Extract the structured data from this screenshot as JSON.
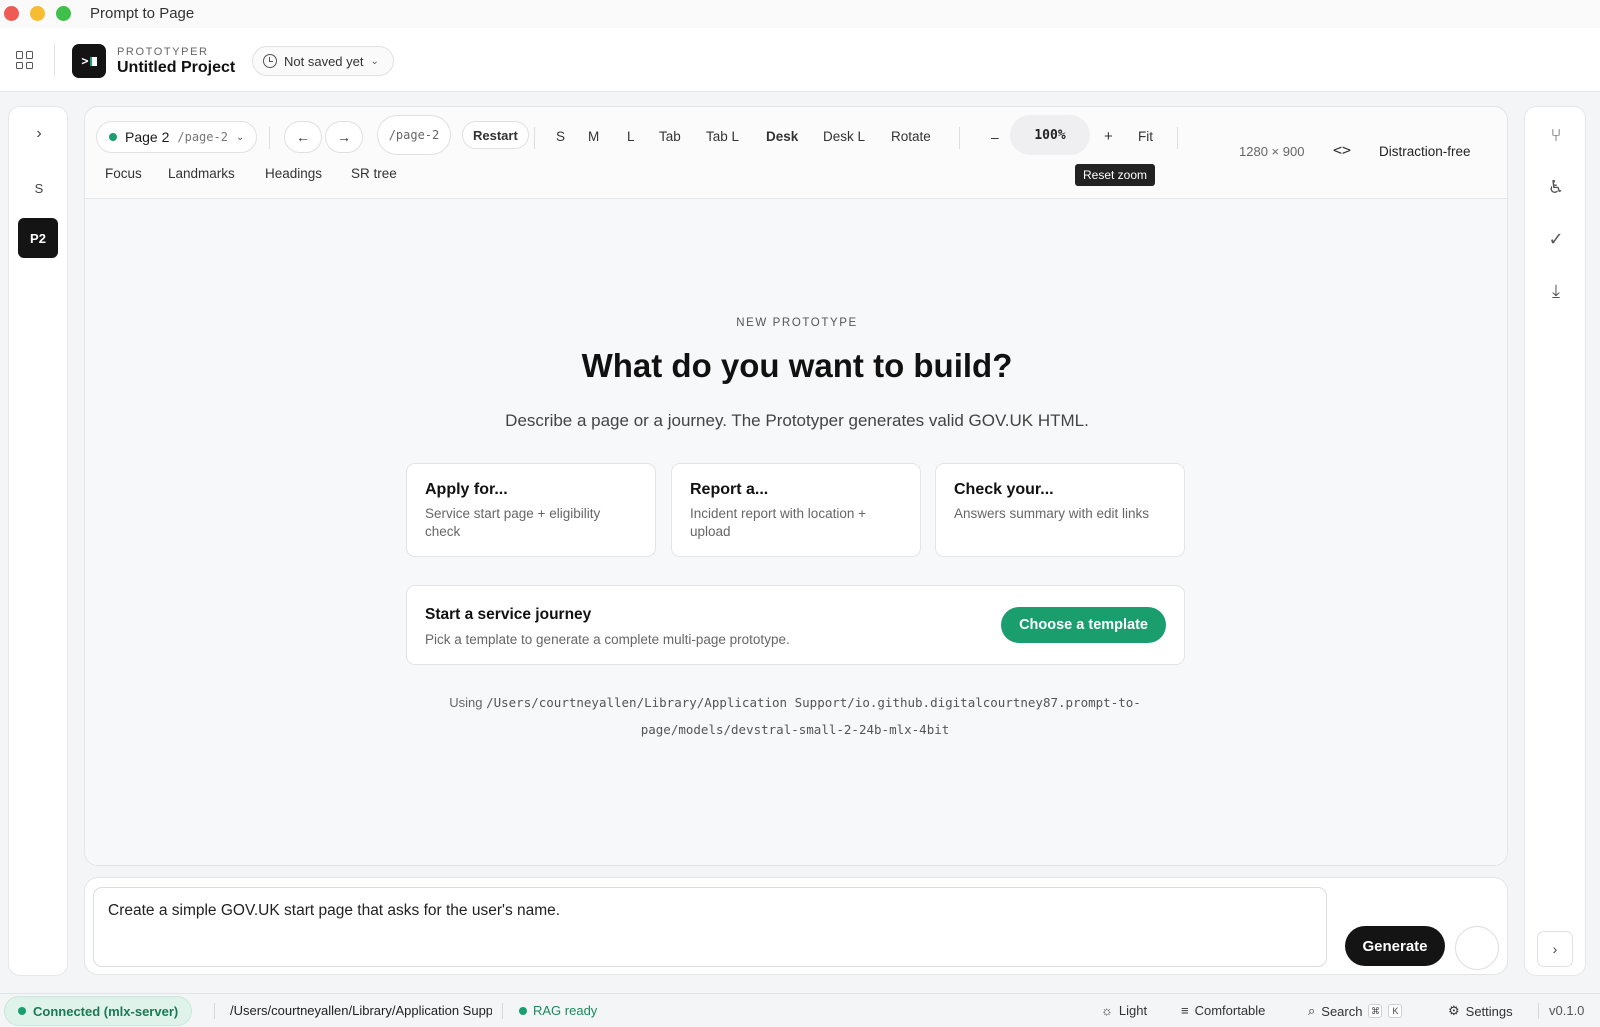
{
  "window": {
    "title": "Prompt to Page"
  },
  "appbar": {
    "brand_small": "PROTOTYPER",
    "project": "Untitled Project",
    "save_status": "Not saved yet"
  },
  "leftrail": {
    "items": [
      "S",
      "P2"
    ]
  },
  "toolbar": {
    "page_label": "Page 2",
    "page_slug": "/page-2",
    "path": "/page-2",
    "restart": "Restart",
    "viewports": [
      "S",
      "M",
      "L",
      "Tab",
      "Tab L",
      "Desk",
      "Desk L",
      "Rotate"
    ],
    "active_viewport": "Desk",
    "zoom_minus": "–",
    "zoom": "100%",
    "zoom_plus": "+",
    "fit": "Fit",
    "tooltip": "Reset zoom",
    "dimensions": "1280 × 900",
    "distraction_free": "Distraction-free",
    "a11y": [
      "Focus",
      "Landmarks",
      "Headings",
      "SR tree"
    ]
  },
  "canvas": {
    "eyebrow": "NEW PROTOTYPE",
    "headline": "What do you want to build?",
    "subline": "Describe a page or a journey. The Prototyper generates valid GOV.UK HTML.",
    "cards": [
      {
        "title": "Apply for...",
        "desc": "Service start page + eligibility check"
      },
      {
        "title": "Report a...",
        "desc": "Incident report with location + upload"
      },
      {
        "title": "Check your...",
        "desc": "Answers summary with edit links"
      }
    ],
    "journey": {
      "title": "Start a service journey",
      "desc": "Pick a template to generate a complete multi-page prototype.",
      "cta": "Choose a template"
    },
    "using_label": "Using",
    "model_path_1": "/Users/courtneyallen/Library/Application Support/io.github.digitalcourtney87.prompt-to-",
    "model_path_2": "page/models/devstral-small-2-24b-mlx-4bit"
  },
  "composer": {
    "prompt": "Create a simple GOV.UK start page that asks for the user's name.",
    "generate": "Generate"
  },
  "statusbar": {
    "connection": "Connected (mlx-server)",
    "path": "/Users/courtneyallen/Library/Application Support",
    "rag": "RAG ready",
    "theme": "Light",
    "density": "Comfortable",
    "search": "Search",
    "kbd_cmd": "⌘",
    "kbd_k": "K",
    "settings": "Settings",
    "version": "v0.1.0"
  },
  "colors": {
    "accent": "#1a9e6e",
    "dark": "#141414"
  }
}
